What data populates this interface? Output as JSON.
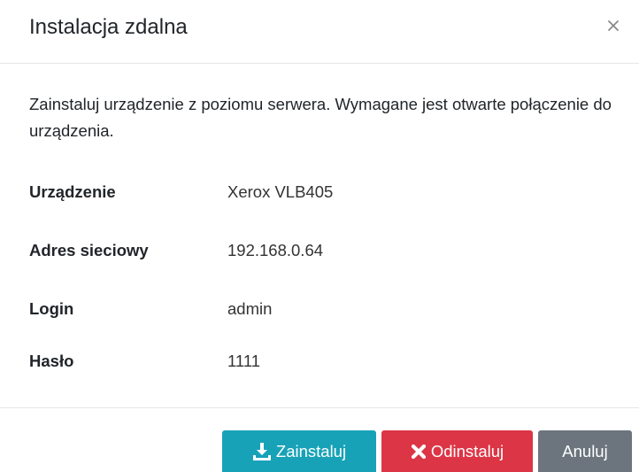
{
  "dialog": {
    "title": "Instalacja zdalna",
    "close_symbol": "×",
    "description": "Zainstaluj urządzenie z poziomu serwera. Wymagane jest otwarte połączenie do urządzenia."
  },
  "fields": {
    "device": {
      "label": "Urządzenie",
      "value": "Xerox VLB405"
    },
    "address": {
      "label": "Adres sieciowy",
      "value": "192.168.0.64"
    },
    "login": {
      "label": "Login",
      "value": "admin"
    },
    "password": {
      "label": "Hasło",
      "value": "1111"
    }
  },
  "buttons": {
    "install": {
      "label": "Zainstaluj",
      "icon": "download-icon",
      "color": "#17a2b8"
    },
    "uninstall": {
      "label": "Odinstaluj",
      "icon": "x-icon",
      "color": "#dc3545"
    },
    "cancel": {
      "label": "Anuluj",
      "color": "#6c757d"
    }
  }
}
